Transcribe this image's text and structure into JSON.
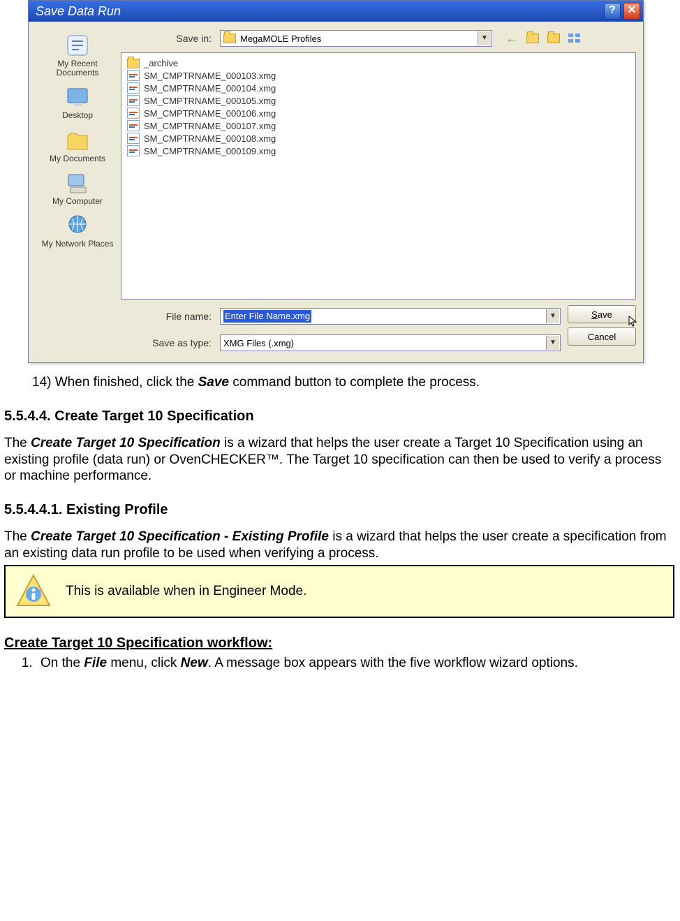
{
  "dialog": {
    "title": "Save Data Run",
    "save_in_label": "Save in:",
    "save_in_value": "MegaMOLE Profiles",
    "places": [
      {
        "label": "My Recent Documents"
      },
      {
        "label": "Desktop"
      },
      {
        "label": "My Documents"
      },
      {
        "label": "My Computer"
      },
      {
        "label": "My Network Places"
      }
    ],
    "files": [
      {
        "type": "folder",
        "name": "_archive"
      },
      {
        "type": "xmg",
        "name": "SM_CMPTRNAME_000103.xmg"
      },
      {
        "type": "xmg",
        "name": "SM_CMPTRNAME_000104.xmg"
      },
      {
        "type": "xmg",
        "name": "SM_CMPTRNAME_000105.xmg"
      },
      {
        "type": "xmg",
        "name": "SM_CMPTRNAME_000106.xmg"
      },
      {
        "type": "xmg",
        "name": "SM_CMPTRNAME_000107.xmg"
      },
      {
        "type": "xmg",
        "name": "SM_CMPTRNAME_000108.xmg"
      },
      {
        "type": "xmg",
        "name": "SM_CMPTRNAME_000109.xmg"
      }
    ],
    "file_name_label": "File name:",
    "file_name_value": "Enter File Name.xmg",
    "save_type_label": "Save as type:",
    "save_type_value": "XMG Files (.xmg)",
    "save_btn": "Save",
    "cancel_btn": "Cancel"
  },
  "doc": {
    "step14_num": "14)",
    "step14_pre": "When finished, click the ",
    "step14_bold": "Save",
    "step14_post": " command button to complete the process.",
    "h_5544": "5.5.4.4. Create Target 10 Specification",
    "p1_a": "The ",
    "p1_bold": "Create Target 10 Specification",
    "p1_b": " is a wizard that helps the user create a Target 10 Specification using an existing profile (data run) or OvenCHECKER™. The Target 10 specification can then be used to verify a process or machine performance.",
    "h_55441": "5.5.4.4.1. Existing Profile",
    "p2_a": "The ",
    "p2_bold": "Create Target 10 Specification - Existing Profile",
    "p2_b": " is a wizard that helps the user create a specification from an existing data run profile to be used when verifying a process.",
    "note": "This is available when in Engineer Mode.",
    "workflow_head": "Create Target 10 Specification workflow:",
    "s1_num": "1)",
    "s1_a": "On the ",
    "s1_b1": "File",
    "s1_b": " menu, click ",
    "s1_b2": "New",
    "s1_c": ". A message box appears with the five workflow wizard options."
  }
}
